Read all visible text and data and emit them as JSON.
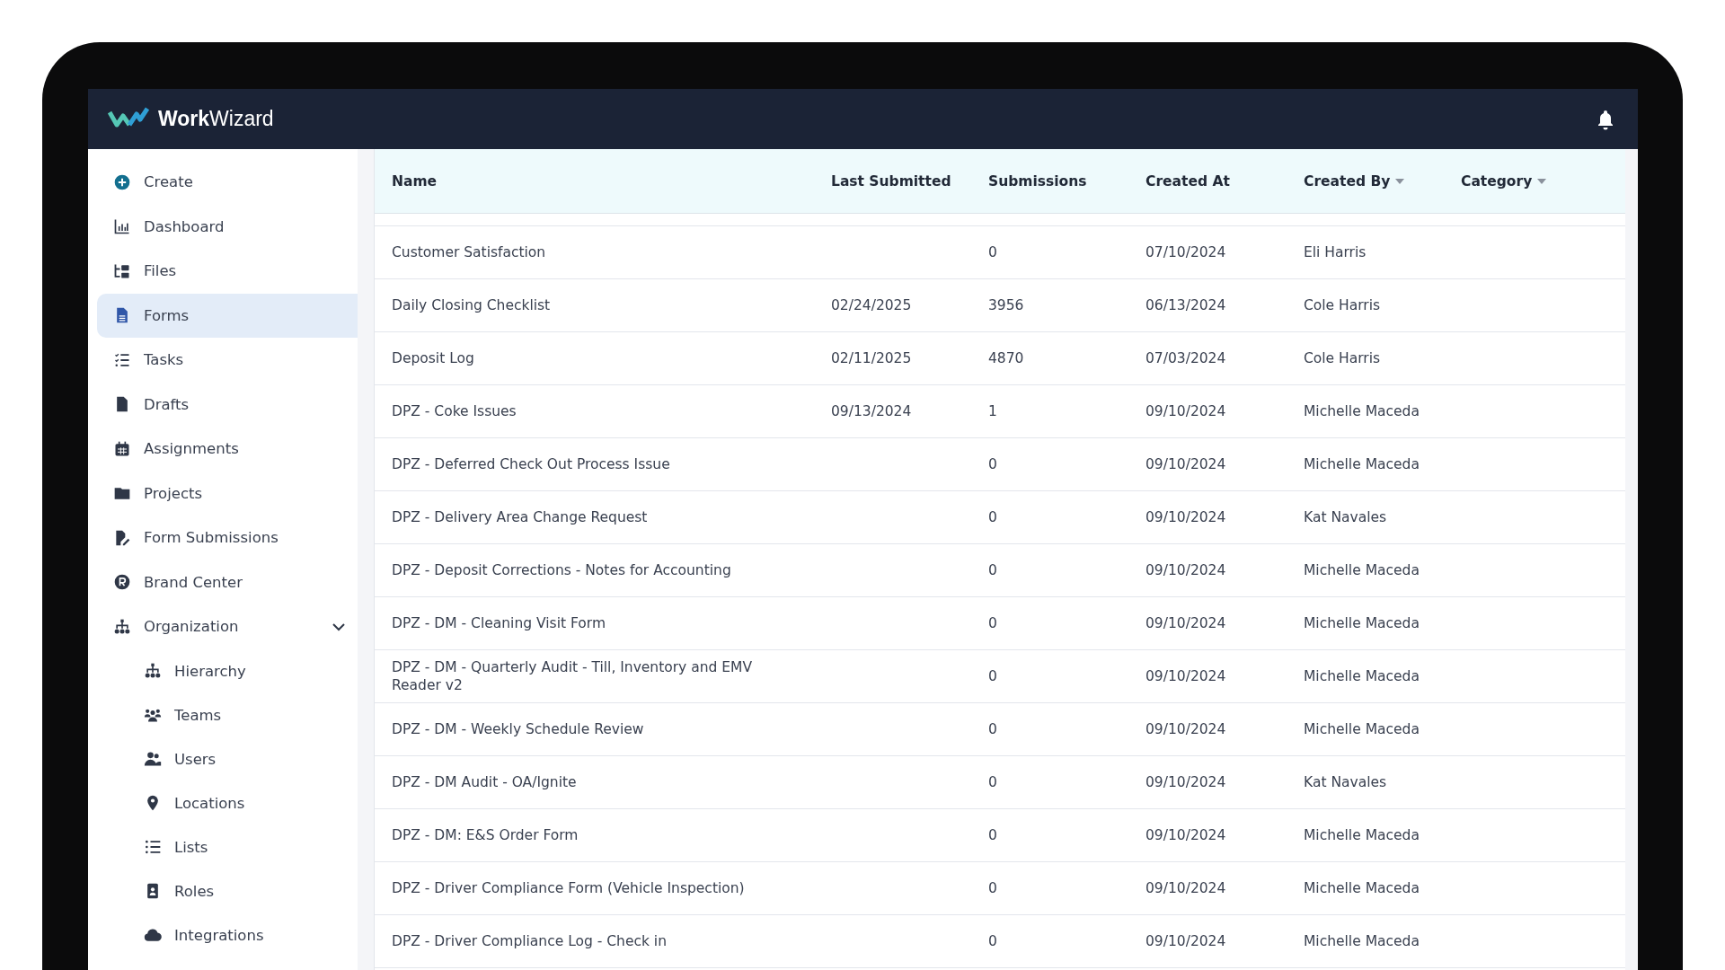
{
  "app": {
    "logo": "**Work**Wizard"
  },
  "sidebar": {
    "items": [
      {
        "label": "Create",
        "selected": false
      },
      {
        "label": "Dashboard",
        "selected": false
      },
      {
        "label": "Files",
        "selected": false
      },
      {
        "label": "Forms",
        "selected": true
      },
      {
        "label": "Tasks",
        "selected": false
      },
      {
        "label": "Drafts",
        "selected": false
      },
      {
        "label": "Assignments",
        "selected": false
      },
      {
        "label": "Projects",
        "selected": false
      },
      {
        "label": "Form Submissions",
        "selected": false
      },
      {
        "label": "Brand Center",
        "selected": false
      },
      {
        "label": "Organization",
        "selected": false,
        "expanded": true,
        "children": [
          {
            "label": "Hierarchy",
            "selected": false
          },
          {
            "label": "Teams",
            "selected": false
          },
          {
            "label": "Users",
            "selected": false
          },
          {
            "label": "Locations",
            "selected": false
          },
          {
            "label": "Lists",
            "selected": false
          },
          {
            "label": "Roles",
            "selected": false
          },
          {
            "label": "Integrations",
            "selected": false
          }
        ]
      }
    ]
  },
  "table": {
    "columns": [
      {
        "label": "Name",
        "filter": false
      },
      {
        "label": "Last Submitted",
        "filter": false
      },
      {
        "label": "Submissions",
        "filter": false
      },
      {
        "label": "Created At",
        "filter": false
      },
      {
        "label": "Created By",
        "filter": true
      },
      {
        "label": "Category",
        "filter": true
      }
    ],
    "rows": [
      [
        "Customer Satisfaction",
        "",
        "0",
        "07/10/2024",
        "Eli Harris",
        ""
      ],
      [
        "Daily Closing Checklist",
        "02/24/2025",
        "3956",
        "06/13/2024",
        "Cole Harris",
        ""
      ],
      [
        "Deposit Log",
        "02/11/2025",
        "4870",
        "07/03/2024",
        "Cole Harris",
        ""
      ],
      [
        "DPZ - Coke Issues",
        "09/13/2024",
        "1",
        "09/10/2024",
        "Michelle Maceda",
        ""
      ],
      [
        "DPZ - Deferred Check Out Process Issue",
        "",
        "0",
        "09/10/2024",
        "Michelle Maceda",
        ""
      ],
      [
        "DPZ - Delivery Area Change Request",
        "",
        "0",
        "09/10/2024",
        "Kat Navales",
        ""
      ],
      [
        "DPZ - Deposit Corrections - Notes for Accounting",
        "",
        "0",
        "09/10/2024",
        "Michelle Maceda",
        ""
      ],
      [
        "DPZ - DM - Cleaning Visit Form",
        "",
        "0",
        "09/10/2024",
        "Michelle Maceda",
        ""
      ],
      [
        "DPZ - DM - Quarterly Audit - Till, Inventory and EMV Reader v2",
        "",
        "0",
        "09/10/2024",
        "Michelle Maceda",
        ""
      ],
      [
        "DPZ - DM - Weekly Schedule Review",
        "",
        "0",
        "09/10/2024",
        "Michelle Maceda",
        ""
      ],
      [
        "DPZ - DM Audit - OA/Ignite",
        "",
        "0",
        "09/10/2024",
        "Kat Navales",
        ""
      ],
      [
        "DPZ - DM: E&S Order Form",
        "",
        "0",
        "09/10/2024",
        "Michelle Maceda",
        ""
      ],
      [
        "DPZ - Driver Compliance Form (Vehicle Inspection)",
        "",
        "0",
        "09/10/2024",
        "Michelle Maceda",
        ""
      ],
      [
        "DPZ - Driver Compliance Log - Check in",
        "",
        "0",
        "09/10/2024",
        "Michelle Maceda",
        ""
      ]
    ]
  }
}
